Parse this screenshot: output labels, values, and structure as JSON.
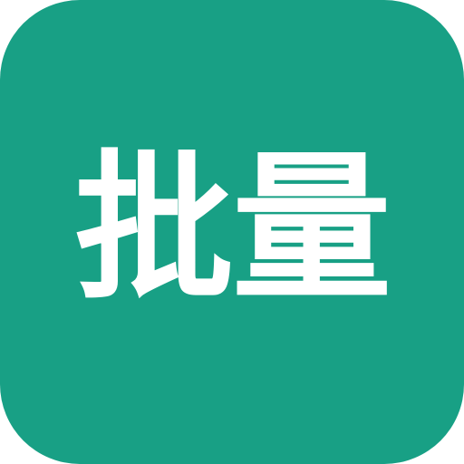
{
  "app_icon": {
    "label": "批量",
    "background_color": "#18a085",
    "text_color": "#ffffff"
  }
}
